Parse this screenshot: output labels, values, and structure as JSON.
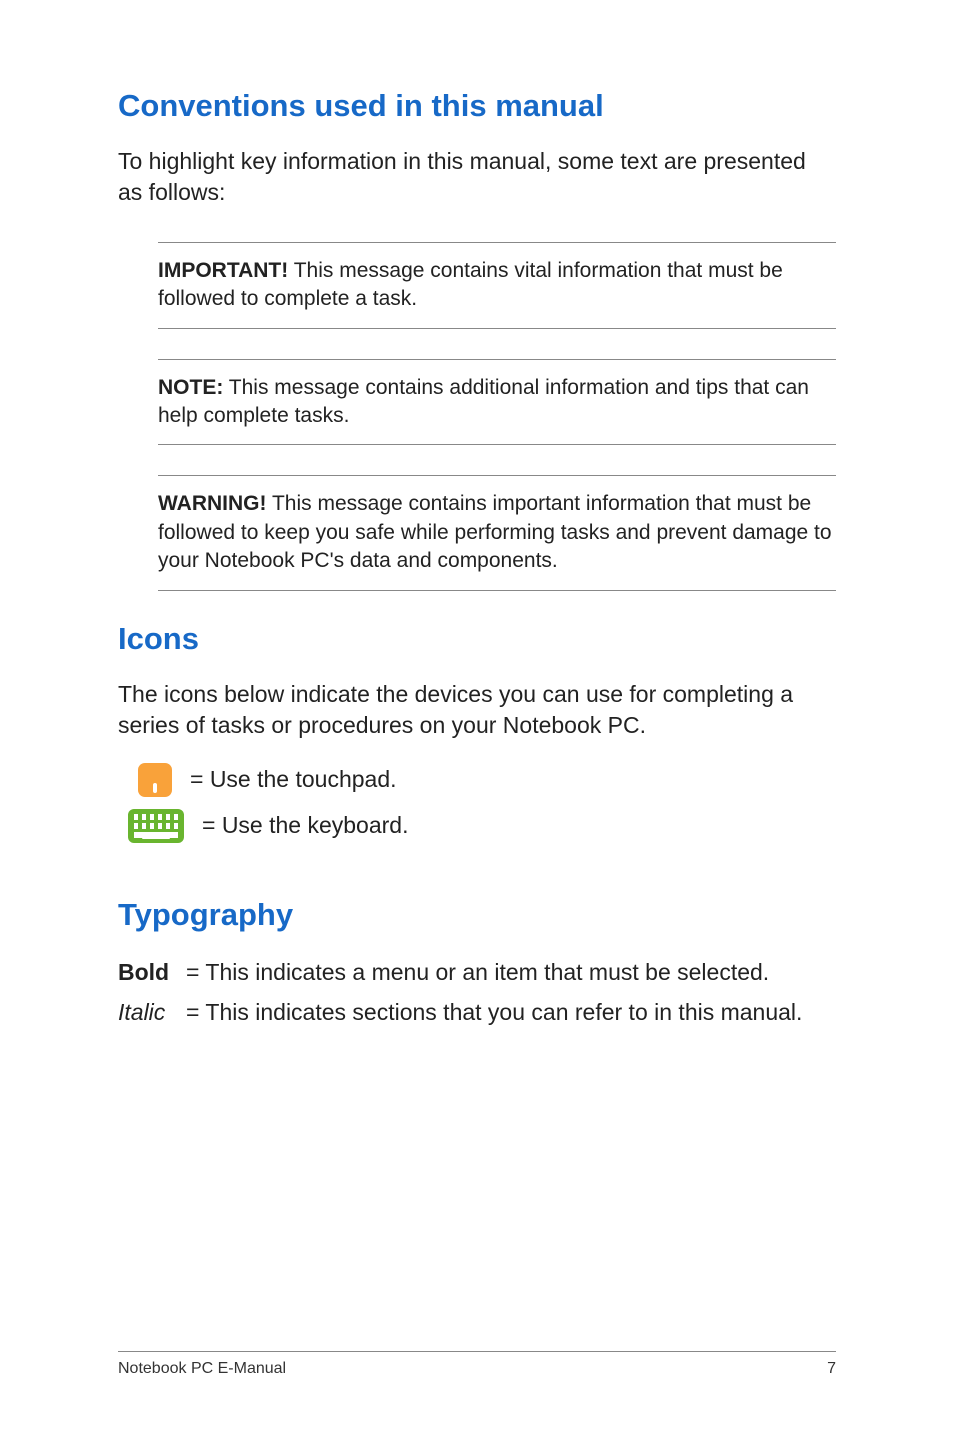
{
  "headings": {
    "conventions": "Conventions used in this manual",
    "icons": "Icons",
    "typography": "Typography"
  },
  "intro": "To highlight key information in this manual, some text are presented as follows:",
  "callouts": {
    "important": {
      "label": "IMPORTANT!",
      "text": " This message contains vital information that must be followed to complete a task."
    },
    "note": {
      "label": "NOTE:",
      "text": " This message contains additional information and tips that can help complete tasks."
    },
    "warning": {
      "label": "WARNING!",
      "text": " This message contains important information that must be followed to keep you safe while performing tasks and prevent damage to your Notebook PC's data and components."
    }
  },
  "icons_desc": "The icons below indicate the devices you can use for completing a series of tasks or procedures on your Notebook PC.",
  "icon_rows": {
    "touchpad": "= Use the touchpad.",
    "keyboard": "= Use the keyboard."
  },
  "typography": {
    "bold_label": "Bold",
    "bold_text": "= This indicates a menu or an item that must be selected.",
    "italic_label": "Italic",
    "italic_text": "= This indicates sections that you can refer to in this manual."
  },
  "footer": {
    "title": "Notebook PC E-Manual",
    "page": "7"
  }
}
